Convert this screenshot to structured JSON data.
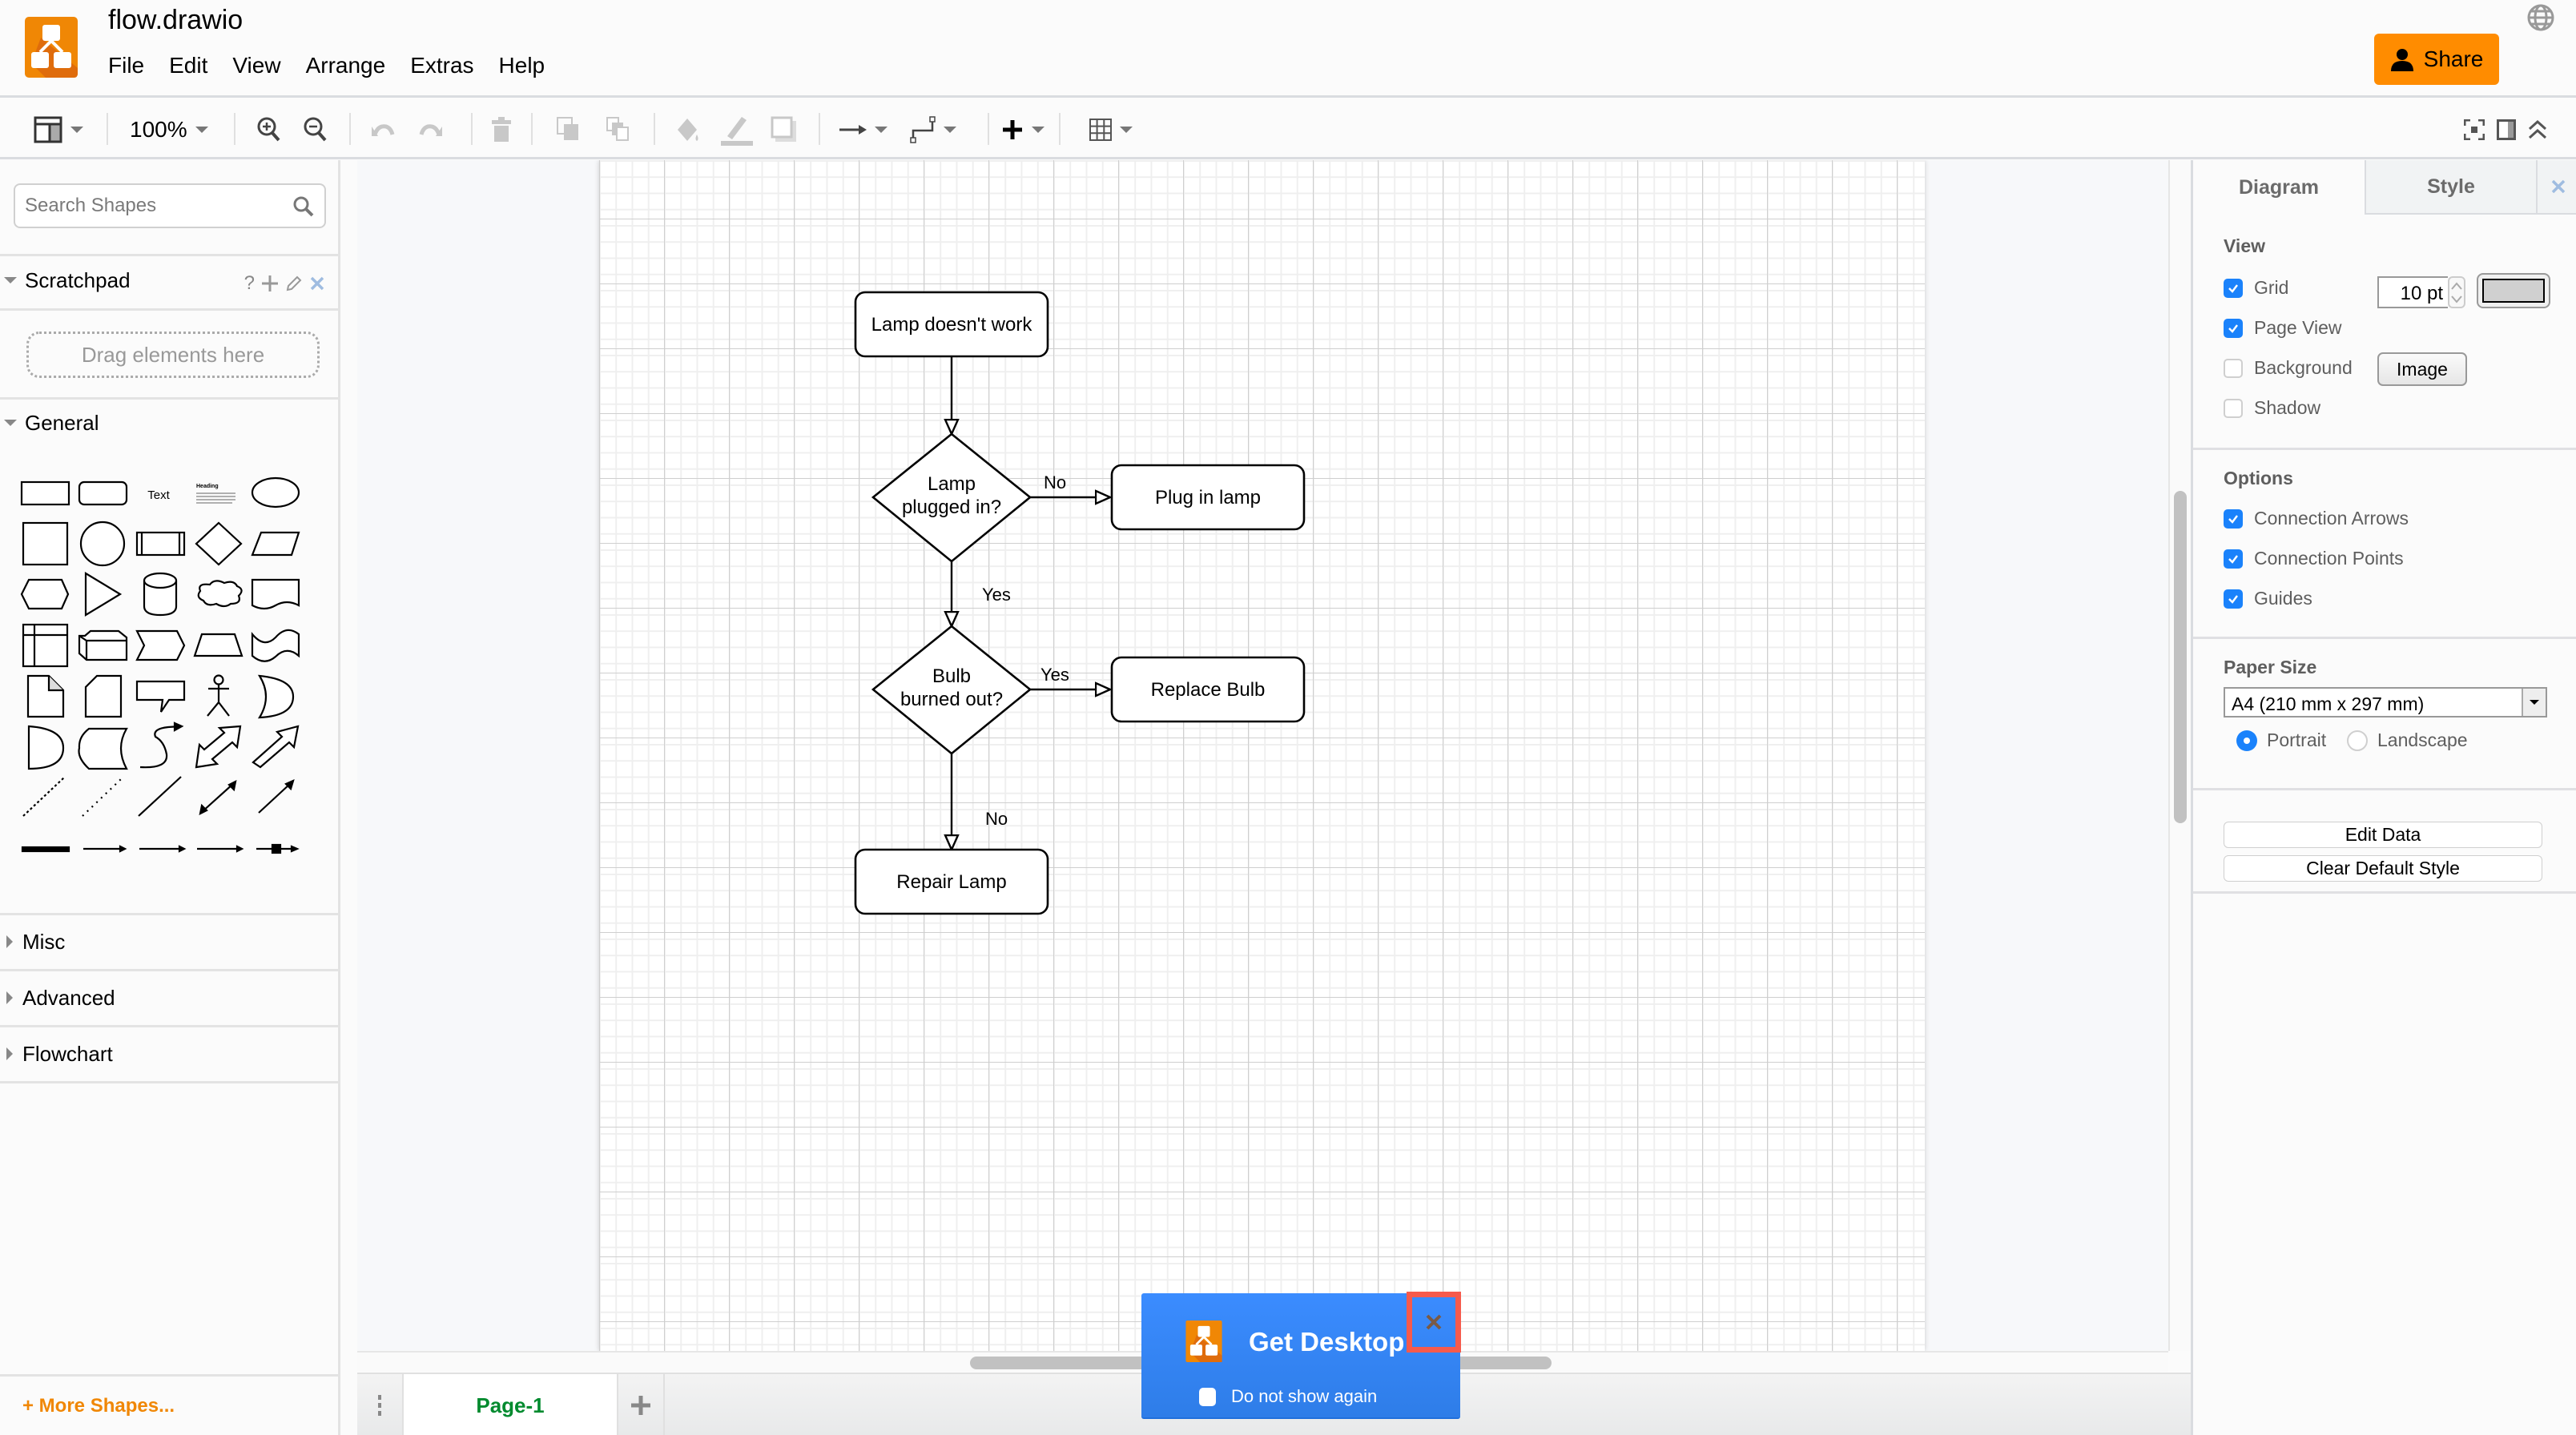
{
  "app": {
    "file_title": "flow.drawio",
    "brand_color": "#f08705",
    "menu": [
      "File",
      "Edit",
      "View",
      "Arrange",
      "Extras",
      "Help"
    ],
    "share_label": "Share",
    "share_icon": "user-icon",
    "language_icon": "globe-icon"
  },
  "toolbar": {
    "zoom_level": "100%",
    "items": [
      "format-panel-toggle",
      "zoom-dropdown",
      "zoom-in",
      "zoom-out",
      "undo",
      "redo",
      "delete",
      "to-front",
      "to-back",
      "fill-color",
      "line-color",
      "shadow",
      "connection-style",
      "waypoints",
      "insert",
      "table"
    ],
    "right_items": [
      "fullscreen",
      "toggle-format-panel",
      "collapse-header"
    ]
  },
  "sidebar": {
    "search_placeholder": "Search Shapes",
    "scratchpad": {
      "label": "Scratchpad",
      "help": "?",
      "drop_hint": "Drag elements here"
    },
    "sections": [
      {
        "label": "General",
        "expanded": true
      },
      {
        "label": "Misc",
        "expanded": false
      },
      {
        "label": "Advanced",
        "expanded": false
      },
      {
        "label": "Flowchart",
        "expanded": false
      }
    ],
    "general_shapes": [
      "rectangle",
      "rounded-rectangle",
      "text",
      "textbox",
      "ellipse",
      "square",
      "circle",
      "process",
      "diamond",
      "parallelogram",
      "hexagon",
      "triangle",
      "cylinder",
      "cloud",
      "document",
      "internal-storage",
      "cube",
      "step",
      "trapezoid",
      "tape",
      "note",
      "card",
      "callout",
      "actor",
      "or",
      "and",
      "data-storage",
      "curved-arrow",
      "bidirectional-arrow",
      "arrow",
      "dashed-line",
      "dotted-line",
      "line",
      "bidirectional-connector",
      "directional-connector",
      "link",
      "connector-with-label",
      "connector-with-2-labels",
      "connector-with-3-labels",
      "connector-with-symbol"
    ],
    "text_shape_label": "Text",
    "textbox_heading": "Heading",
    "more_shapes_label": "+ More Shapes..."
  },
  "diagram": {
    "nodes": [
      {
        "id": "start",
        "type": "rounded-rect",
        "label": [
          "Lamp doesn't work"
        ]
      },
      {
        "id": "plugged",
        "type": "diamond",
        "label": [
          "Lamp",
          "plugged in?"
        ]
      },
      {
        "id": "plug",
        "type": "rounded-rect",
        "label": [
          "Plug in lamp"
        ]
      },
      {
        "id": "bulb",
        "type": "diamond",
        "label": [
          "Bulb",
          "burned out?"
        ]
      },
      {
        "id": "replace",
        "type": "rounded-rect",
        "label": [
          "Replace Bulb"
        ]
      },
      {
        "id": "repair",
        "type": "rounded-rect",
        "label": [
          "Repair Lamp"
        ]
      }
    ],
    "edges": [
      {
        "from": "start",
        "to": "plugged",
        "label": ""
      },
      {
        "from": "plugged",
        "to": "plug",
        "label": "No"
      },
      {
        "from": "plugged",
        "to": "bulb",
        "label": "Yes"
      },
      {
        "from": "bulb",
        "to": "replace",
        "label": "Yes"
      },
      {
        "from": "bulb",
        "to": "repair",
        "label": "No"
      }
    ]
  },
  "pages": {
    "tabs": [
      {
        "label": "Page-1",
        "active": true
      }
    ],
    "active_color": "#008a2e"
  },
  "format_panel": {
    "tabs": [
      {
        "label": "Diagram",
        "active": true
      },
      {
        "label": "Style",
        "active": false
      }
    ],
    "view": {
      "title": "View",
      "grid": {
        "label": "Grid",
        "checked": true,
        "size": "10 pt",
        "color": "#d0d0d0"
      },
      "page_view": {
        "label": "Page View",
        "checked": true
      },
      "background": {
        "label": "Background",
        "checked": false,
        "button": "Image"
      },
      "shadow": {
        "label": "Shadow",
        "checked": false
      }
    },
    "options": {
      "title": "Options",
      "connection_arrows": {
        "label": "Connection Arrows",
        "checked": true
      },
      "connection_points": {
        "label": "Connection Points",
        "checked": true
      },
      "guides": {
        "label": "Guides",
        "checked": true
      }
    },
    "paper": {
      "title": "Paper Size",
      "selected": "A4 (210 mm x 297 mm)",
      "portrait": {
        "label": "Portrait",
        "selected": true
      },
      "landscape": {
        "label": "Landscape",
        "selected": false
      }
    },
    "buttons": {
      "edit_data": "Edit Data",
      "clear_default_style": "Clear Default Style"
    },
    "accent_color": "#1a82fb"
  },
  "popup": {
    "title": "Get Desktop",
    "checkbox_label": "Do not show again",
    "checkbox_checked": false,
    "close_label": "×",
    "background_color": "#3b8cff",
    "highlight_color": "#f65a4c"
  }
}
